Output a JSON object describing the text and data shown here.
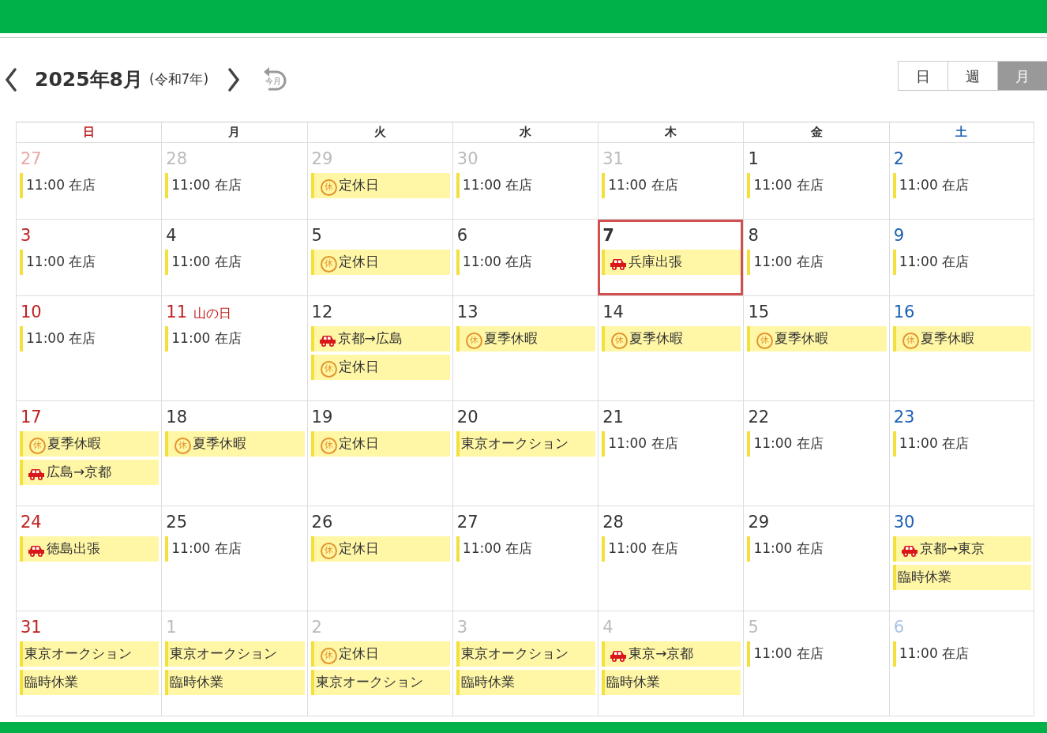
{
  "header": {
    "title": "2025年8月",
    "era": "(令和7年)",
    "today_button": "今月"
  },
  "views": [
    {
      "label": "日",
      "selected": false
    },
    {
      "label": "週",
      "selected": false
    },
    {
      "label": "月",
      "selected": true
    }
  ],
  "weekdays": [
    "日",
    "月",
    "火",
    "水",
    "木",
    "金",
    "土"
  ],
  "weeks": [
    [
      {
        "day": "27",
        "other_month": true,
        "events": [
          {
            "kind": "open",
            "label": "11:00 在店"
          }
        ]
      },
      {
        "day": "28",
        "other_month": true,
        "events": [
          {
            "kind": "open",
            "label": "11:00 在店"
          }
        ]
      },
      {
        "day": "29",
        "other_month": true,
        "events": [
          {
            "kind": "closed",
            "badge": "休",
            "label": "定休日"
          }
        ]
      },
      {
        "day": "30",
        "other_month": true,
        "events": [
          {
            "kind": "open",
            "label": "11:00 在店"
          }
        ]
      },
      {
        "day": "31",
        "other_month": true,
        "events": [
          {
            "kind": "open",
            "label": "11:00 在店"
          }
        ]
      },
      {
        "day": "1",
        "other_month": false,
        "events": [
          {
            "kind": "open",
            "label": "11:00 在店"
          }
        ]
      },
      {
        "day": "2",
        "other_month": false,
        "events": [
          {
            "kind": "open",
            "label": "11:00 在店"
          }
        ]
      }
    ],
    [
      {
        "day": "3",
        "other_month": false,
        "events": [
          {
            "kind": "open",
            "label": "11:00 在店"
          }
        ]
      },
      {
        "day": "4",
        "other_month": false,
        "events": [
          {
            "kind": "open",
            "label": "11:00 在店"
          }
        ]
      },
      {
        "day": "5",
        "other_month": false,
        "events": [
          {
            "kind": "closed",
            "badge": "休",
            "label": "定休日"
          }
        ]
      },
      {
        "day": "6",
        "other_month": false,
        "events": [
          {
            "kind": "open",
            "label": "11:00 在店"
          }
        ]
      },
      {
        "day": "7",
        "other_month": false,
        "today": true,
        "events": [
          {
            "kind": "car",
            "label": "兵庫出張"
          }
        ]
      },
      {
        "day": "8",
        "other_month": false,
        "events": [
          {
            "kind": "open",
            "label": "11:00 在店"
          }
        ]
      },
      {
        "day": "9",
        "other_month": false,
        "events": [
          {
            "kind": "open",
            "label": "11:00 在店"
          }
        ]
      }
    ],
    [
      {
        "day": "10",
        "other_month": false,
        "events": [
          {
            "kind": "open",
            "label": "11:00 在店"
          }
        ]
      },
      {
        "day": "11",
        "other_month": false,
        "holiday": "山の日",
        "events": [
          {
            "kind": "open",
            "label": "11:00 在店"
          }
        ]
      },
      {
        "day": "12",
        "other_month": false,
        "events": [
          {
            "kind": "car",
            "label": "京都→広島"
          },
          {
            "kind": "closed",
            "badge": "休",
            "label": "定休日"
          }
        ]
      },
      {
        "day": "13",
        "other_month": false,
        "events": [
          {
            "kind": "closed",
            "badge": "休",
            "label": "夏季休暇"
          }
        ]
      },
      {
        "day": "14",
        "other_month": false,
        "events": [
          {
            "kind": "closed",
            "badge": "休",
            "label": "夏季休暇"
          }
        ]
      },
      {
        "day": "15",
        "other_month": false,
        "events": [
          {
            "kind": "closed",
            "badge": "休",
            "label": "夏季休暇"
          }
        ]
      },
      {
        "day": "16",
        "other_month": false,
        "events": [
          {
            "kind": "closed",
            "badge": "休",
            "label": "夏季休暇"
          }
        ]
      }
    ],
    [
      {
        "day": "17",
        "other_month": false,
        "events": [
          {
            "kind": "closed",
            "badge": "休",
            "label": "夏季休暇"
          },
          {
            "kind": "car",
            "label": "広島→京都"
          }
        ]
      },
      {
        "day": "18",
        "other_month": false,
        "events": [
          {
            "kind": "closed",
            "badge": "休",
            "label": "夏季休暇"
          }
        ]
      },
      {
        "day": "19",
        "other_month": false,
        "events": [
          {
            "kind": "closed",
            "badge": "休",
            "label": "定休日"
          }
        ]
      },
      {
        "day": "20",
        "other_month": false,
        "events": [
          {
            "kind": "plain",
            "label": "東京オークション"
          }
        ]
      },
      {
        "day": "21",
        "other_month": false,
        "events": [
          {
            "kind": "open",
            "label": "11:00 在店"
          }
        ]
      },
      {
        "day": "22",
        "other_month": false,
        "events": [
          {
            "kind": "open",
            "label": "11:00 在店"
          }
        ]
      },
      {
        "day": "23",
        "other_month": false,
        "events": [
          {
            "kind": "open",
            "label": "11:00 在店"
          }
        ]
      }
    ],
    [
      {
        "day": "24",
        "other_month": false,
        "events": [
          {
            "kind": "car",
            "label": "徳島出張"
          }
        ]
      },
      {
        "day": "25",
        "other_month": false,
        "events": [
          {
            "kind": "open",
            "label": "11:00 在店"
          }
        ]
      },
      {
        "day": "26",
        "other_month": false,
        "events": [
          {
            "kind": "closed",
            "badge": "休",
            "label": "定休日"
          }
        ]
      },
      {
        "day": "27",
        "other_month": false,
        "events": [
          {
            "kind": "open",
            "label": "11:00 在店"
          }
        ]
      },
      {
        "day": "28",
        "other_month": false,
        "events": [
          {
            "kind": "open",
            "label": "11:00 在店"
          }
        ]
      },
      {
        "day": "29",
        "other_month": false,
        "events": [
          {
            "kind": "open",
            "label": "11:00 在店"
          }
        ]
      },
      {
        "day": "30",
        "other_month": false,
        "events": [
          {
            "kind": "car",
            "label": "京都→東京"
          },
          {
            "kind": "plain",
            "label": "臨時休業"
          }
        ]
      }
    ],
    [
      {
        "day": "31",
        "other_month": false,
        "events": [
          {
            "kind": "plain",
            "label": "東京オークション"
          },
          {
            "kind": "plain",
            "label": "臨時休業"
          }
        ]
      },
      {
        "day": "1",
        "other_month": true,
        "events": [
          {
            "kind": "plain",
            "label": "東京オークション"
          },
          {
            "kind": "plain",
            "label": "臨時休業"
          }
        ]
      },
      {
        "day": "2",
        "other_month": true,
        "events": [
          {
            "kind": "closed",
            "badge": "休",
            "label": "定休日"
          },
          {
            "kind": "plain",
            "label": "東京オークション"
          }
        ]
      },
      {
        "day": "3",
        "other_month": true,
        "events": [
          {
            "kind": "plain",
            "label": "東京オークション"
          },
          {
            "kind": "plain",
            "label": "臨時休業"
          }
        ]
      },
      {
        "day": "4",
        "other_month": true,
        "events": [
          {
            "kind": "car",
            "label": "東京→京都"
          },
          {
            "kind": "plain",
            "label": "臨時休業"
          }
        ]
      },
      {
        "day": "5",
        "other_month": true,
        "events": [
          {
            "kind": "open",
            "label": "11:00 在店"
          }
        ]
      },
      {
        "day": "6",
        "other_month": true,
        "events": [
          {
            "kind": "open",
            "label": "11:00 在店"
          }
        ]
      }
    ]
  ]
}
